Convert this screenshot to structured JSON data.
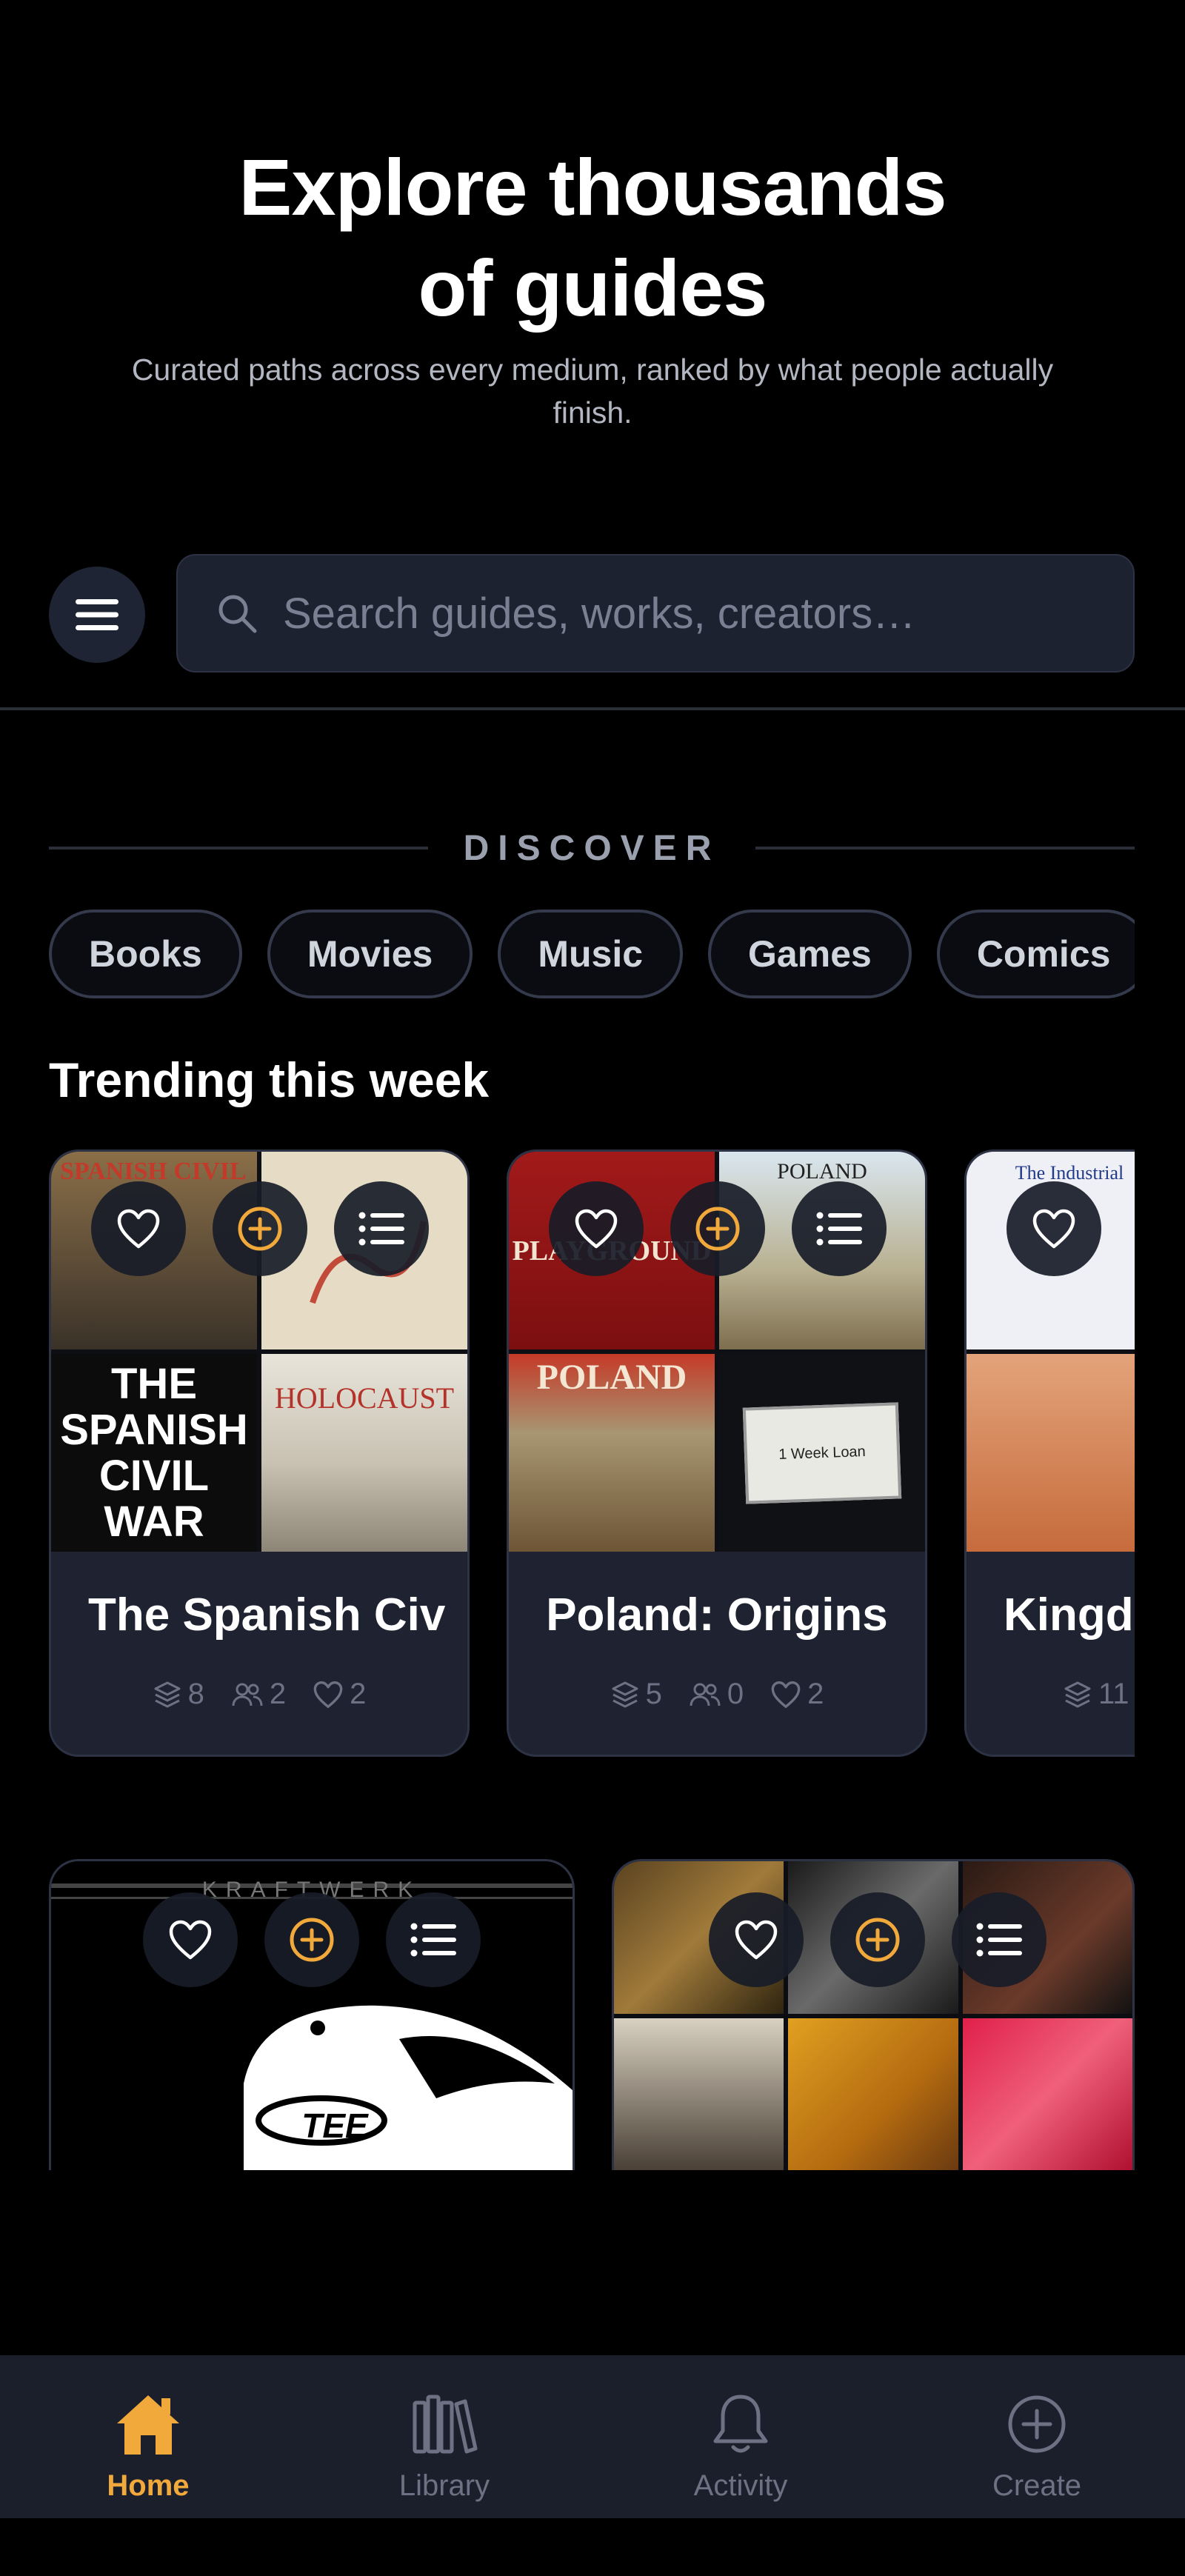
{
  "hero": {
    "title_line1": "Explore thousands",
    "title_line2": "of guides",
    "subtitle": "Curated paths across every medium, ranked by what people actually finish."
  },
  "search": {
    "placeholder": "Search guides, works, creators…"
  },
  "discover": {
    "label": "DISCOVER",
    "chips": [
      "Books",
      "Movies",
      "Music",
      "Games",
      "Comics"
    ]
  },
  "trending": {
    "title": "Trending this week",
    "cards": [
      {
        "title": "The Spanish Civ",
        "works": "8",
        "followers": "2",
        "likes": "2",
        "covers": [
          "SPANISH CIVIL",
          "",
          "THE SPANISH CIVIL WAR",
          "HOLOCAUST"
        ]
      },
      {
        "title": "Poland: Origins",
        "works": "5",
        "followers": "0",
        "likes": "2",
        "covers": [
          "PLAYGROUND",
          "POLAND",
          "POLAND",
          "1 Week Loan"
        ]
      },
      {
        "title": "Kingd",
        "works": "11",
        "followers": "",
        "likes": "",
        "covers": [
          "The Industrial",
          "",
          "",
          ""
        ]
      }
    ]
  },
  "second_row": {
    "cards": [
      {
        "cover_text": "KRAFTWERK",
        "cover_badge": "TEE"
      },
      {
        "covers": [
          "",
          "",
          "",
          "",
          "",
          ""
        ]
      }
    ]
  },
  "bottom_nav": {
    "items": [
      {
        "label": "Home",
        "icon": "home-icon",
        "active": true
      },
      {
        "label": "Library",
        "icon": "library-icon",
        "active": false
      },
      {
        "label": "Activity",
        "icon": "bell-icon",
        "active": false
      },
      {
        "label": "Create",
        "icon": "plus-circle-icon",
        "active": false
      }
    ]
  },
  "colors": {
    "accent": "#f2a93b",
    "card": "#1e2231",
    "background": "#000000"
  }
}
